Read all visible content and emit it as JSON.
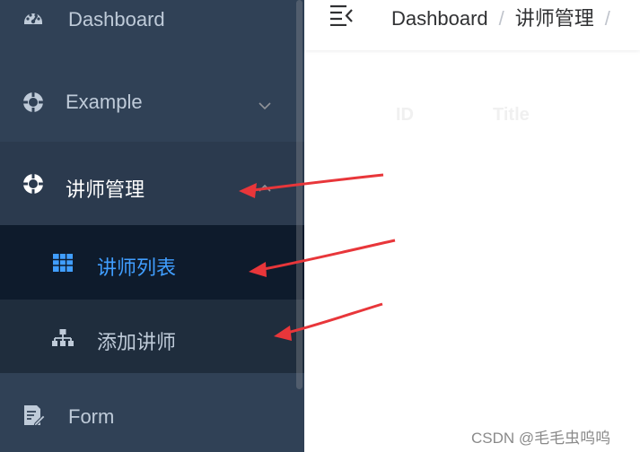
{
  "sidebar": {
    "items": [
      {
        "label": "Dashboard",
        "icon": "dashboard-icon"
      },
      {
        "label": "Example",
        "icon": "example-icon"
      },
      {
        "label": "讲师管理",
        "icon": "example-icon"
      },
      {
        "label": "讲师列表",
        "icon": "table-icon"
      },
      {
        "label": "添加讲师",
        "icon": "tree-icon"
      },
      {
        "label": "Form",
        "icon": "form-icon"
      }
    ]
  },
  "navbar": {
    "breadcrumb": [
      "Dashboard",
      "讲师管理"
    ],
    "separator": "/"
  },
  "table": {
    "headers": [
      "ID",
      "Title"
    ]
  },
  "watermark": "CSDN @毛毛虫呜呜",
  "colors": {
    "sidebar_bg": "#304156",
    "submenu_bg": "#1f2d3d",
    "active_bg": "#0e1b2c",
    "active_text": "#409eff",
    "menu_text": "#bfcbd9",
    "annotation_arrow": "#e8363a"
  }
}
